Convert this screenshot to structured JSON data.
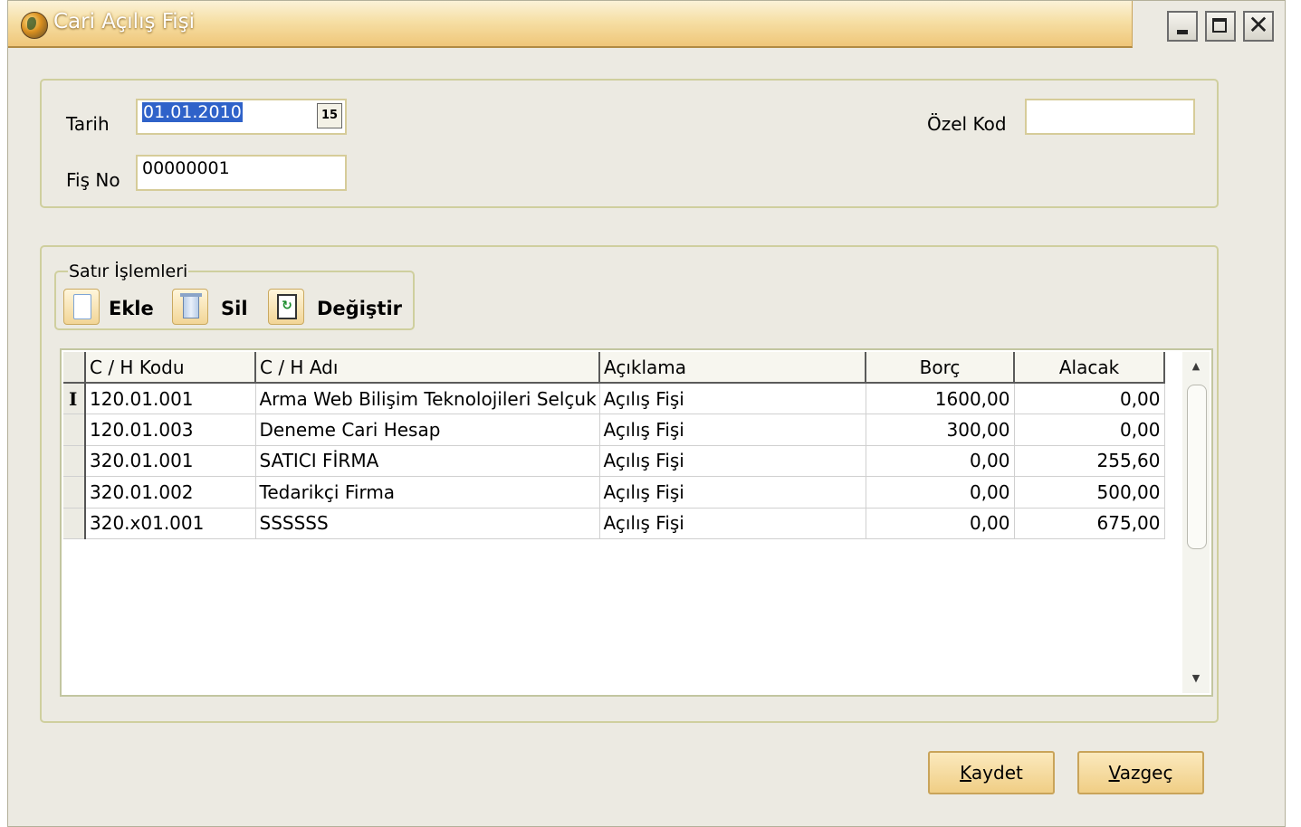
{
  "window": {
    "title": "Cari Açılış Fişi"
  },
  "header": {
    "tarih_label": "Tarih",
    "tarih_value": "01.01.2010",
    "calendar_icon_text": "15",
    "fisno_label": "Fiş No",
    "fisno_value": "00000001",
    "ozelkod_label": "Özel Kod",
    "ozelkod_value": ""
  },
  "row_ops": {
    "legend": "Satır İşlemleri",
    "buttons": [
      {
        "label": "Ekle",
        "icon": "new-page-icon"
      },
      {
        "label": "Sil",
        "icon": "trash-icon"
      },
      {
        "label": "Değiştir",
        "icon": "edit-document-icon"
      }
    ]
  },
  "grid": {
    "columns": [
      "C / H Kodu",
      "C / H Adı",
      "Açıklama",
      "Borç",
      "Alacak"
    ],
    "rows": [
      {
        "kod": "120.01.001",
        "ad": "Arma Web Bilişim Teknolojileri Selçuk Nu",
        "aciklama": "Açılış Fişi",
        "borc": "1600,00",
        "alacak": "0,00"
      },
      {
        "kod": "120.01.003",
        "ad": "Deneme Cari Hesap",
        "aciklama": "Açılış Fişi",
        "borc": "300,00",
        "alacak": "0,00"
      },
      {
        "kod": "320.01.001",
        "ad": "SATICI FİRMA",
        "aciklama": "Açılış Fişi",
        "borc": "0,00",
        "alacak": "255,60"
      },
      {
        "kod": "320.01.002",
        "ad": "Tedarikçi Firma",
        "aciklama": "Açılış Fişi",
        "borc": "0,00",
        "alacak": "500,00"
      },
      {
        "kod": "320.x01.001",
        "ad": "SSSSSS",
        "aciklama": "Açılış Fişi",
        "borc": "0,00",
        "alacak": "675,00"
      }
    ]
  },
  "footer": {
    "kaydet_first": "K",
    "kaydet_rest": "aydet",
    "vazgec_first": "V",
    "vazgec_rest": "azgeç"
  },
  "colors": {
    "title_gradient_start": "#fbf2d8",
    "title_gradient_end": "#efc679",
    "window_bg": "#eceae2",
    "button_bg": "#f0ce85"
  }
}
